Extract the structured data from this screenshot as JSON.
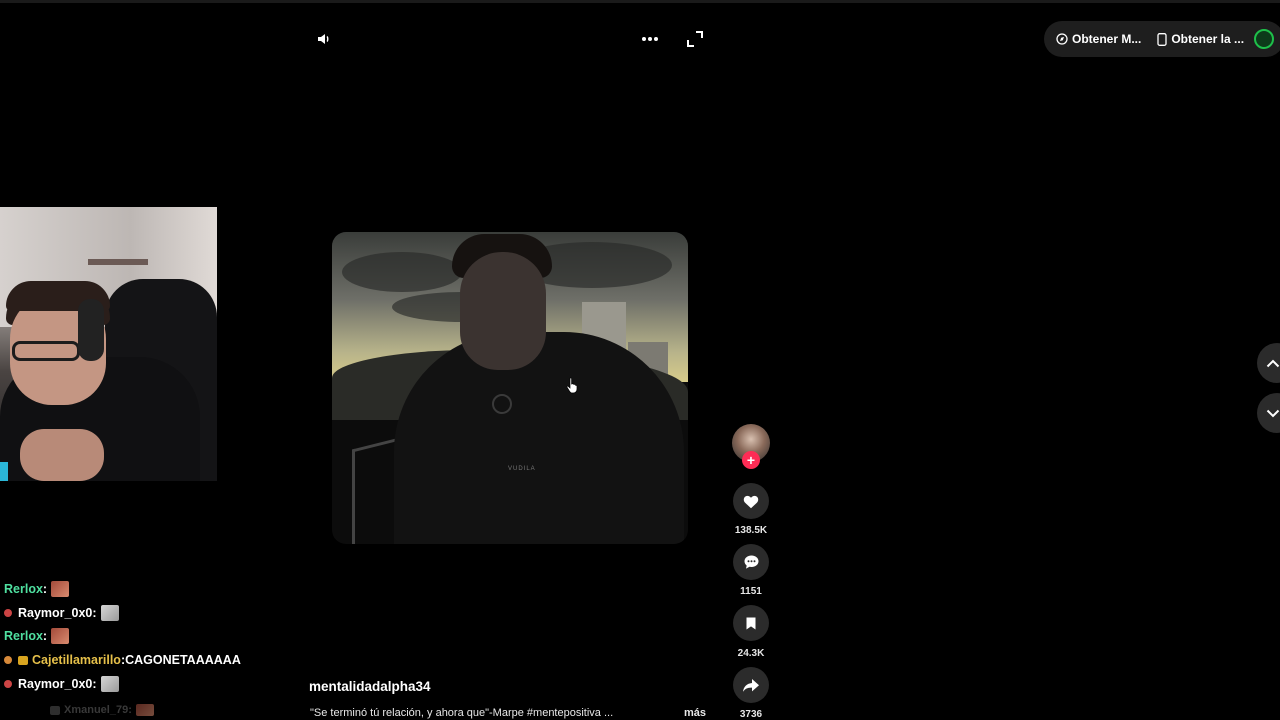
{
  "toolbar": {
    "pills": [
      {
        "label": "Obtener M...",
        "icon": "compass-icon"
      },
      {
        "label": "Obtener la ...",
        "icon": "phone-icon"
      }
    ]
  },
  "chat": {
    "messages": [
      {
        "user": "Rerlox",
        "sep": " :",
        "text": ""
      },
      {
        "user": "Raymor_0x0",
        "sep": " :",
        "text": ""
      },
      {
        "user": "Rerlox",
        "sep": " :",
        "text": ""
      },
      {
        "user": "Cajetillamarillo",
        "sep": " :",
        "text": " CAGONETAAAAAA"
      },
      {
        "user": "Raymor_0x0",
        "sep": " :",
        "text": ""
      },
      {
        "user": "Xmanuel_79",
        "sep": " :",
        "text": ""
      }
    ]
  },
  "video": {
    "author": "mentalidadalpha34",
    "caption": "\"Se terminó tú relación, y ahora que\"-Marpe #mentepositiva ...",
    "more_label": "más",
    "hoodie_text": "VUDILA"
  },
  "actions": {
    "likes": "138.5K",
    "comments": "1151",
    "saves": "24.3K",
    "shares": "3736",
    "follow_symbol": "+"
  },
  "colors": {
    "accent": "#fe2c55",
    "button_bg": "#2b2b2b",
    "chat_green": "#4fe0a0",
    "chat_yellow": "#e6c04a"
  }
}
